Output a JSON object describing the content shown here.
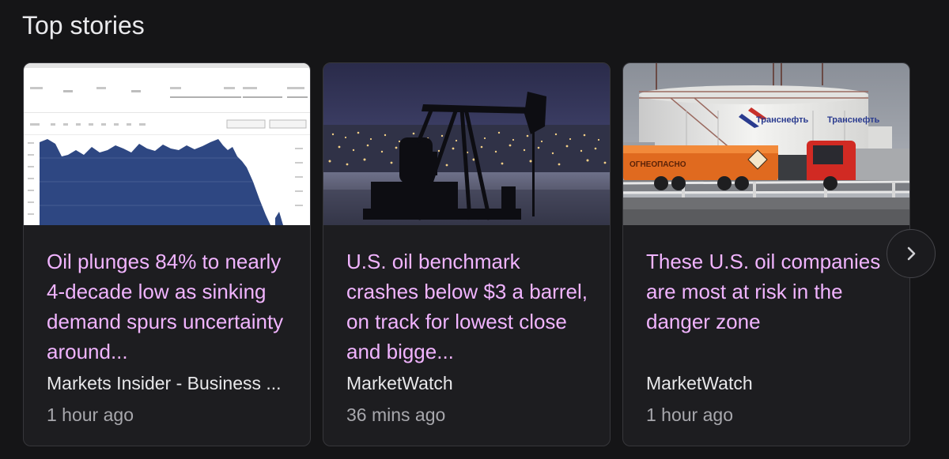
{
  "section": {
    "title": "Top stories"
  },
  "stories": [
    {
      "headline": "Oil plunges 84% to nearly 4-decade low as sinking demand spurs uncertainty around...",
      "source": "Markets Insider - Business ...",
      "time": "1 hour ago"
    },
    {
      "headline": "U.S. oil benchmark crashes below $3 a barrel, on track for lowest close and bigge...",
      "source": "MarketWatch",
      "time": "36 mins ago"
    },
    {
      "headline": "These U.S. oil companies are most at risk in the danger zone",
      "source": "MarketWatch",
      "time": "1 hour ago"
    }
  ],
  "thumbnail_text": {
    "tanker_brand": "Транснефть",
    "truck_label": "ОГНЕОПАСНО"
  },
  "colors": {
    "background": "#151517",
    "card": "#1d1d20",
    "headline": "#f1b4ff",
    "source": "#e8e8ea",
    "time": "#a8a8ad"
  },
  "icons": {
    "next": "chevron-right-icon"
  }
}
